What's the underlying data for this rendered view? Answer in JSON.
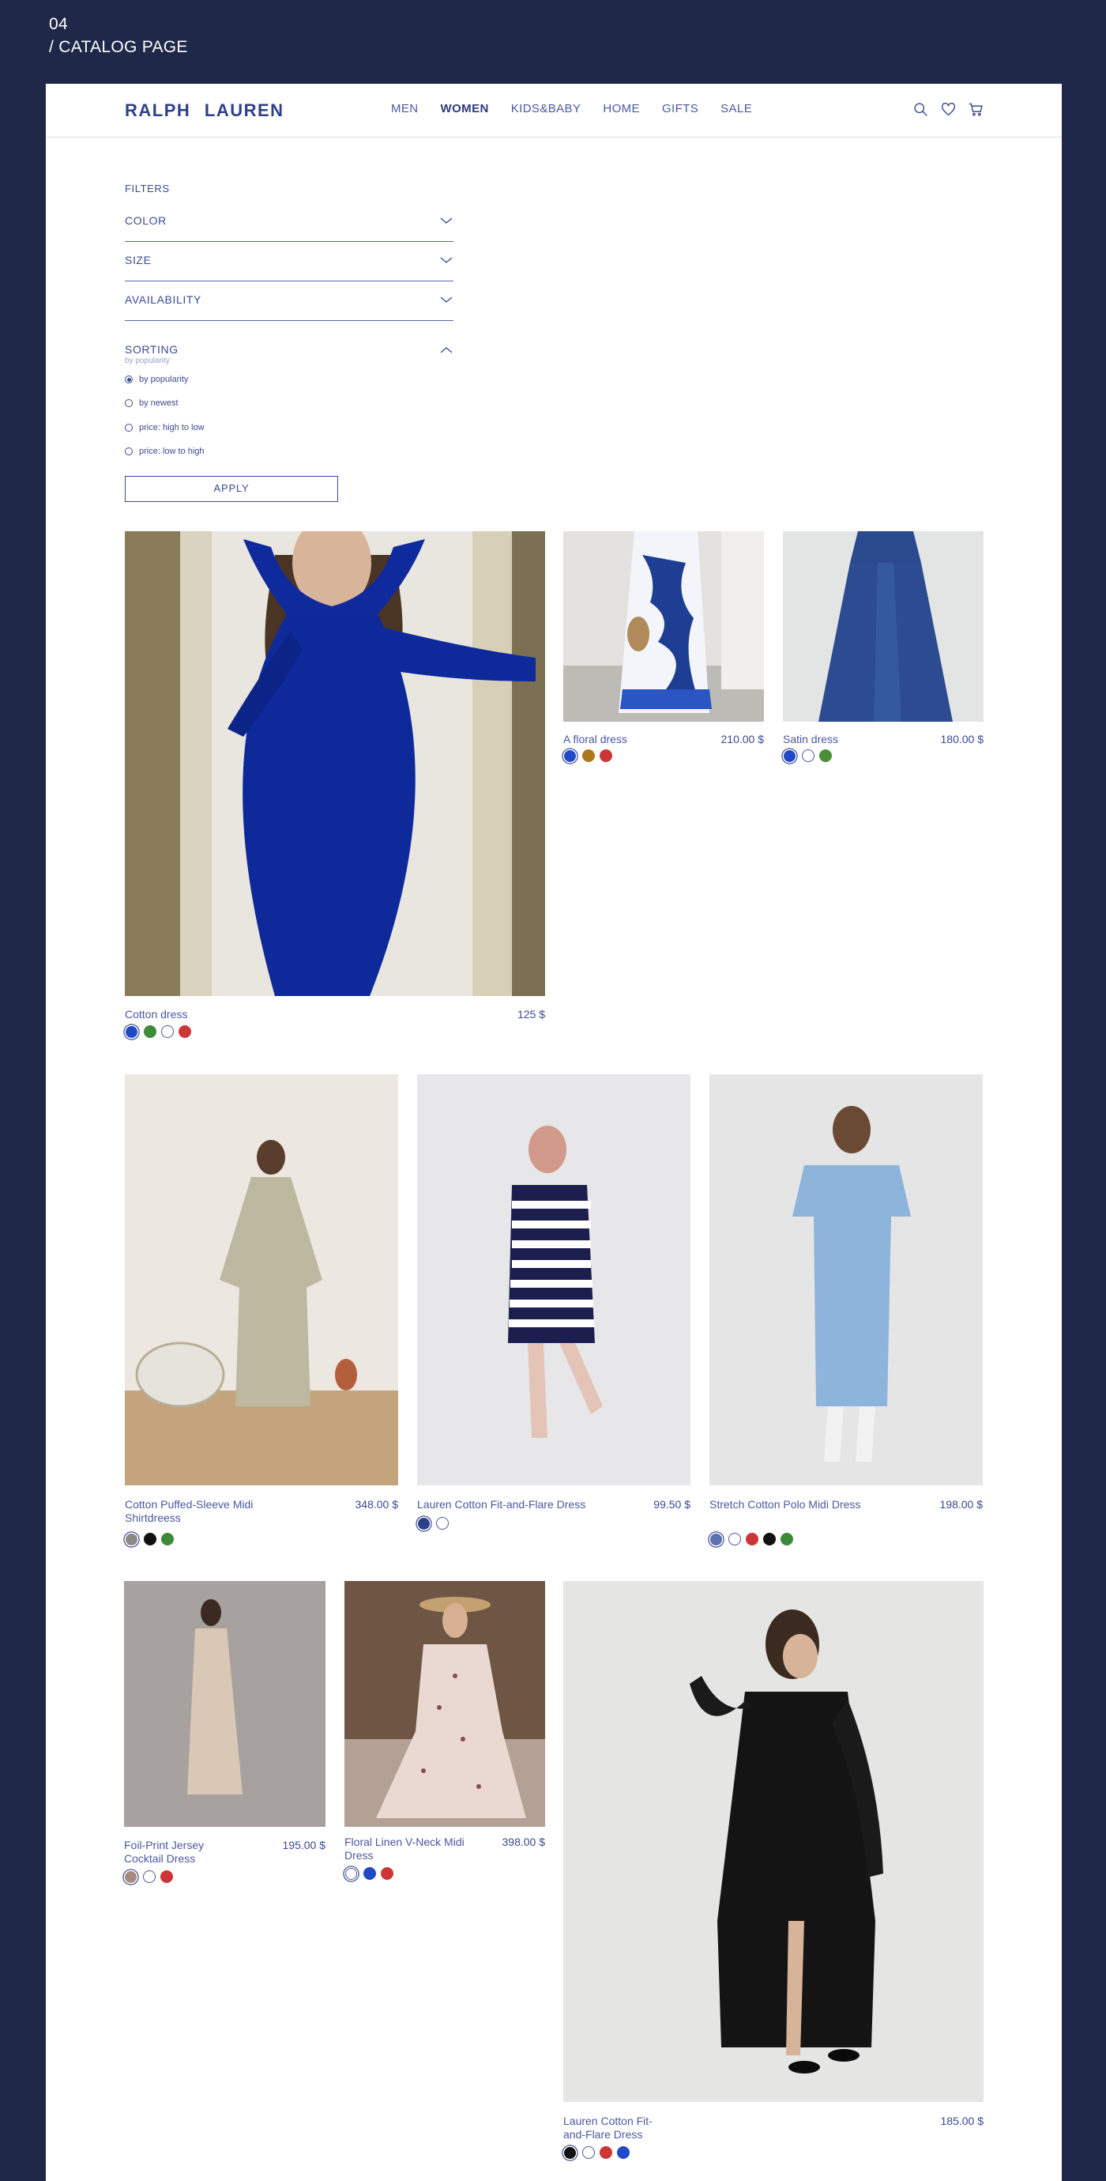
{
  "slide": {
    "number": "04",
    "title": "/ CATALOG PAGE"
  },
  "header": {
    "logo": "RALPH LAUREN",
    "nav": [
      "MEN",
      "WOMEN",
      "KIDS&BABY",
      "HOME",
      "GIFTS",
      "SALE"
    ],
    "active_nav": "WOMEN",
    "icons": [
      "search-icon",
      "heart-icon",
      "cart-icon"
    ]
  },
  "filters": {
    "title": "FILTERS",
    "groups": [
      "COLOR",
      "SIZE",
      "AVAILABILITY"
    ],
    "sorting": {
      "label": "SORTING",
      "current": "by popularity",
      "options": [
        "by popularity",
        "by newest",
        "price: high to low",
        "price: low to high"
      ],
      "selected": "by popularity"
    },
    "apply_label": "APPLY"
  },
  "products": [
    {
      "name": "Cotton dress",
      "price": "125 $",
      "colors": [
        "#1f49c7",
        "#3d8a3a",
        "#ffffff",
        "#cc3636"
      ]
    },
    {
      "name": "A floral dress",
      "price": "210.00 $",
      "colors": [
        "#1f49c7",
        "#b0771a",
        "#cc3636"
      ]
    },
    {
      "name": "Satin dress",
      "price": "180.00 $",
      "colors": [
        "#1f49c7",
        "#ffffff",
        "#4a8f33"
      ]
    },
    {
      "name": "Cotton Puffed-Sleeve Midi Shirtdreess",
      "price": "348.00 $",
      "colors": [
        "#8d8a86",
        "#111111",
        "#3d8a3a"
      ]
    },
    {
      "name": "Lauren Cotton Fit-and-Flare Dress",
      "price": "99.50 $",
      "colors": [
        "#2e3f8a",
        "#ffffff"
      ]
    },
    {
      "name": "Stretch Cotton Polo Midi Dress",
      "price": "198.00 $",
      "colors": [
        "#5c6fae",
        "#ffffff",
        "#cc3636",
        "#111111",
        "#3d8a3a"
      ]
    },
    {
      "name": "Foil-Print Jersey Cocktail Dress",
      "price": "195.00 $",
      "colors": [
        "#a48d80",
        "#ffffff",
        "#cc3636"
      ]
    },
    {
      "name": "Floral Linen V-Neck Midi Dress",
      "price": "398.00 $",
      "colors": [
        "#ffffff",
        "#1f49c7",
        "#cc3636"
      ]
    },
    {
      "name": "Lauren Cotton Fit-and-Flare Dress",
      "price": "185.00 $",
      "colors": [
        "#111111",
        "#ffffff",
        "#cc3636",
        "#1f49c7"
      ]
    }
  ]
}
